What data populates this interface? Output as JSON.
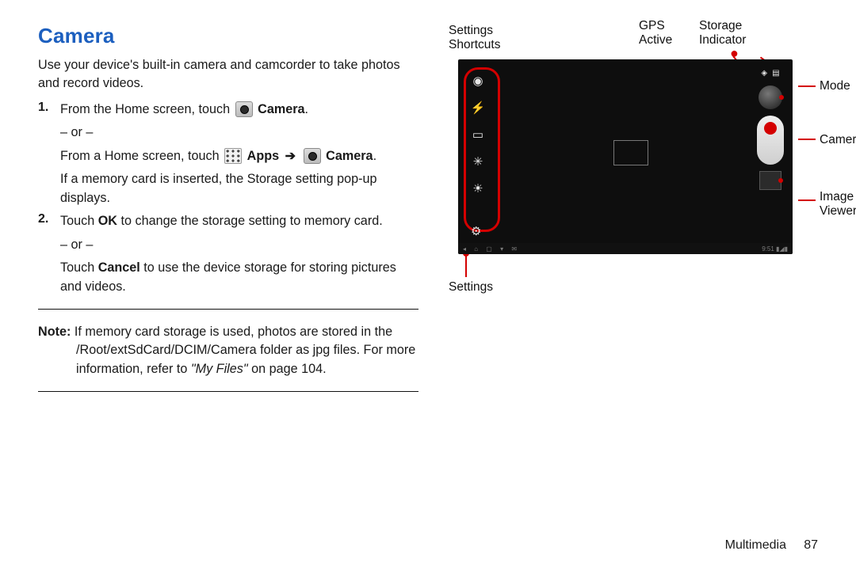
{
  "title": "Camera",
  "intro": "Use your device's built-in camera and camcorder to take photos and record videos.",
  "steps": {
    "1": {
      "prefix": "From the Home screen, touch ",
      "camera": "Camera",
      "or": "– or –",
      "alt_prefix": "From a Home screen, touch ",
      "apps": "Apps",
      "arrow": "➔",
      "camera2": "Camera",
      "suffix": ".",
      "memcard": "If a memory card is inserted, the Storage setting pop-up displays."
    },
    "2": {
      "line1a": "Touch ",
      "ok": "OK",
      "line1b": " to change the storage setting to memory card.",
      "or": "– or –",
      "line2a": "Touch ",
      "cancel": "Cancel",
      "line2b": " to use the device storage for storing pictures and videos."
    }
  },
  "note": {
    "label": "Note:",
    "body_a": " If memory card storage is used, photos are stored in the /Root/extSdCard/DCIM/Camera folder as jpg files. For more information, refer to ",
    "myfiles": "\"My Files\"",
    "body_b": "  on page 104."
  },
  "callouts": {
    "settings_shortcuts": "Settings Shortcuts",
    "gps_active": "GPS Active",
    "storage_indicator": "Storage Indicator",
    "mode": "Mode",
    "camera": "Camera",
    "image_viewer": "Image Viewer",
    "settings": "Settings"
  },
  "nav": {
    "time": "9:51"
  },
  "footer": {
    "section": "Multimedia",
    "page": "87"
  }
}
